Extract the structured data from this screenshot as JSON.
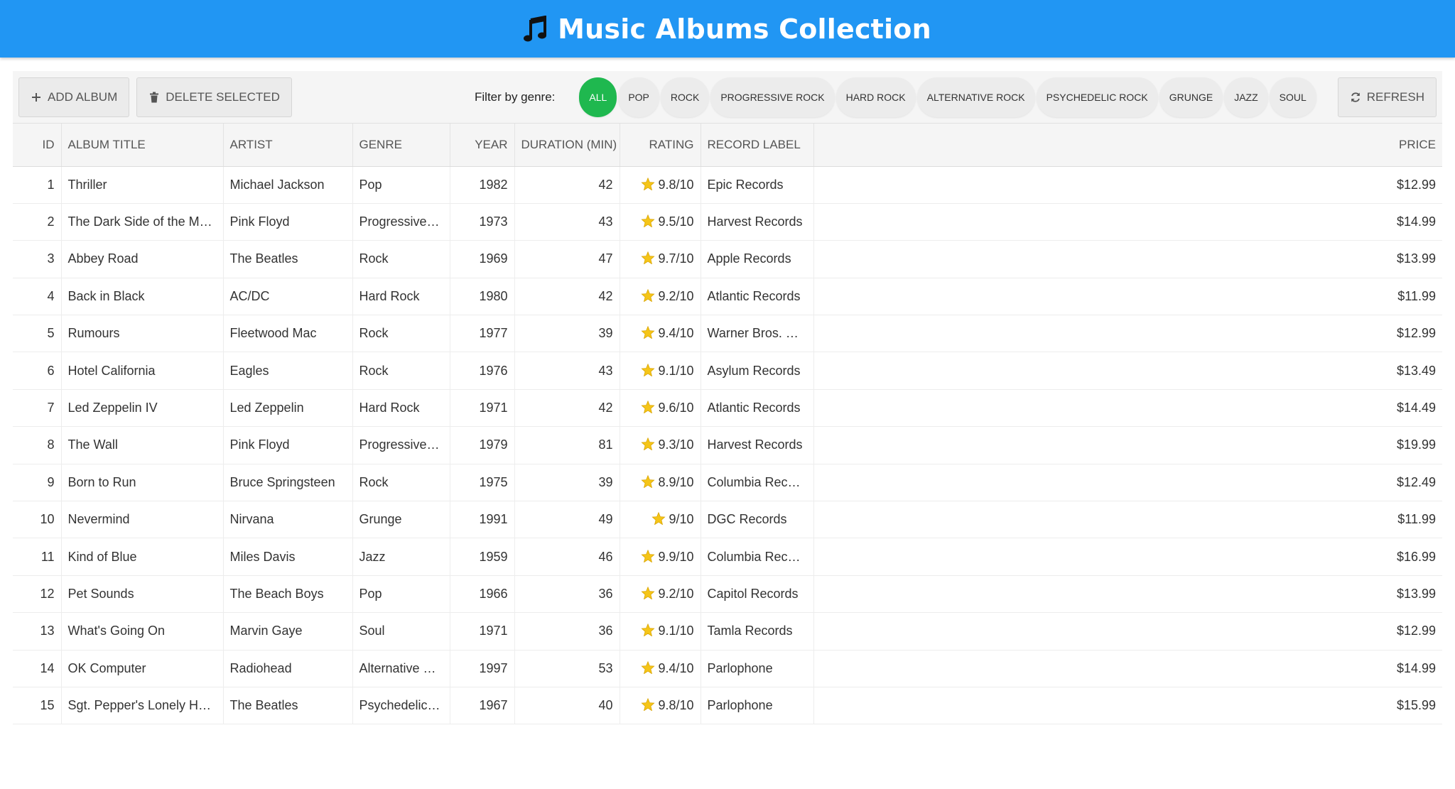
{
  "header": {
    "title": "Music Albums Collection",
    "icon": "music-note-icon"
  },
  "toolbar": {
    "add_label": "Add Album",
    "delete_label": "Delete Selected",
    "filter_label": "Filter by genre:",
    "refresh_label": "Refresh",
    "genres": [
      "All",
      "Pop",
      "Rock",
      "Progressive Rock",
      "Hard Rock",
      "Alternative Rock",
      "Psychedelic Rock",
      "Grunge",
      "Jazz",
      "Soul"
    ],
    "active_genre": "All"
  },
  "colors": {
    "header": "#2196f3",
    "active_chip": "#1fb84f",
    "star": "#f5c518"
  },
  "table": {
    "columns": [
      "ID",
      "Album Title",
      "Artist",
      "Genre",
      "Year",
      "Duration (min)",
      "Rating",
      "Record Label",
      "Price"
    ],
    "rows": [
      [
        "1",
        "Thriller",
        "Michael Jackson",
        "Pop",
        "1982",
        "42",
        "9.8/10",
        "Epic Records",
        "$12.99"
      ],
      [
        "2",
        "The Dark Side of the Moon",
        "Pink Floyd",
        "Progressive Rock",
        "1973",
        "43",
        "9.5/10",
        "Harvest Records",
        "$14.99"
      ],
      [
        "3",
        "Abbey Road",
        "The Beatles",
        "Rock",
        "1969",
        "47",
        "9.7/10",
        "Apple Records",
        "$13.99"
      ],
      [
        "4",
        "Back in Black",
        "AC/DC",
        "Hard Rock",
        "1980",
        "42",
        "9.2/10",
        "Atlantic Records",
        "$11.99"
      ],
      [
        "5",
        "Rumours",
        "Fleetwood Mac",
        "Rock",
        "1977",
        "39",
        "9.4/10",
        "Warner Bros. Records",
        "$12.99"
      ],
      [
        "6",
        "Hotel California",
        "Eagles",
        "Rock",
        "1976",
        "43",
        "9.1/10",
        "Asylum Records",
        "$13.49"
      ],
      [
        "7",
        "Led Zeppelin IV",
        "Led Zeppelin",
        "Hard Rock",
        "1971",
        "42",
        "9.6/10",
        "Atlantic Records",
        "$14.49"
      ],
      [
        "8",
        "The Wall",
        "Pink Floyd",
        "Progressive Rock",
        "1979",
        "81",
        "9.3/10",
        "Harvest Records",
        "$19.99"
      ],
      [
        "9",
        "Born to Run",
        "Bruce Springsteen",
        "Rock",
        "1975",
        "39",
        "8.9/10",
        "Columbia Records",
        "$12.49"
      ],
      [
        "10",
        "Nevermind",
        "Nirvana",
        "Grunge",
        "1991",
        "49",
        "9/10",
        "DGC Records",
        "$11.99"
      ],
      [
        "11",
        "Kind of Blue",
        "Miles Davis",
        "Jazz",
        "1959",
        "46",
        "9.9/10",
        "Columbia Records",
        "$16.99"
      ],
      [
        "12",
        "Pet Sounds",
        "The Beach Boys",
        "Pop",
        "1966",
        "36",
        "9.2/10",
        "Capitol Records",
        "$13.99"
      ],
      [
        "13",
        "What's Going On",
        "Marvin Gaye",
        "Soul",
        "1971",
        "36",
        "9.1/10",
        "Tamla Records",
        "$12.99"
      ],
      [
        "14",
        "OK Computer",
        "Radiohead",
        "Alternative Rock",
        "1997",
        "53",
        "9.4/10",
        "Parlophone",
        "$14.99"
      ],
      [
        "15",
        "Sgt. Pepper's Lonely Hearts Club Band",
        "The Beatles",
        "Psychedelic Rock",
        "1967",
        "40",
        "9.8/10",
        "Parlophone",
        "$15.99"
      ]
    ]
  }
}
